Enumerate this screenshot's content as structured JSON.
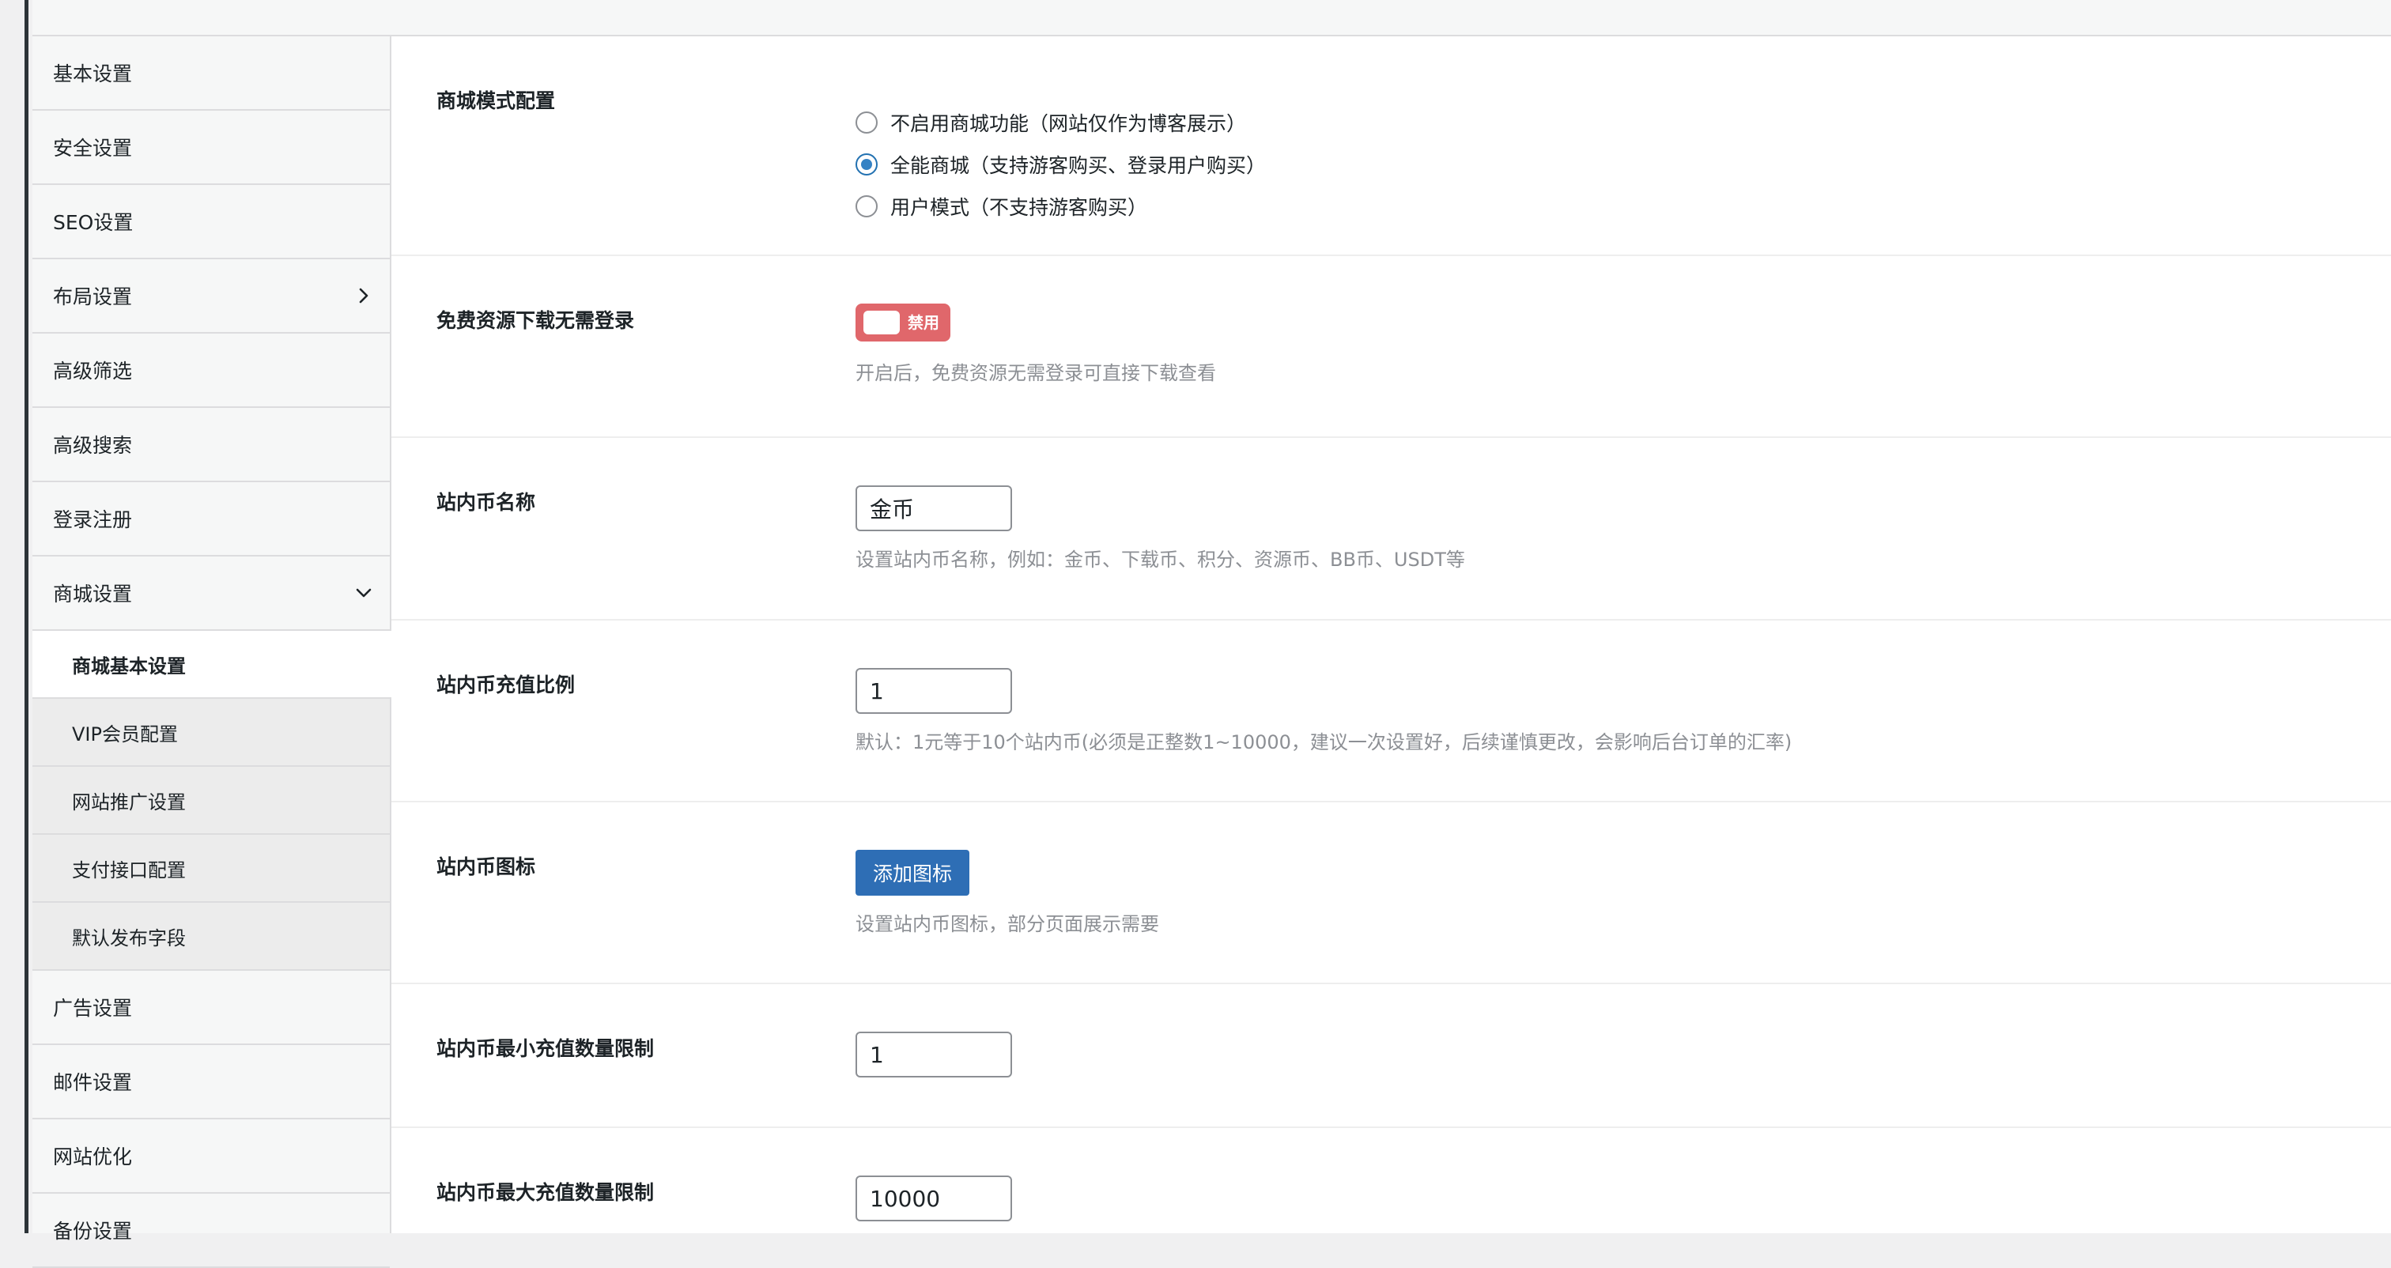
{
  "sidebar": {
    "items": [
      {
        "label": "基本设置"
      },
      {
        "label": "安全设置"
      },
      {
        "label": "SEO设置"
      },
      {
        "label": "布局设置",
        "chevron": "chevron-right-icon"
      },
      {
        "label": "高级筛选"
      },
      {
        "label": "高级搜索"
      },
      {
        "label": "登录注册"
      },
      {
        "label": "商城设置",
        "chevron": "chevron-down-icon"
      }
    ],
    "sub_items": [
      {
        "label": "商城基本设置",
        "active": true
      },
      {
        "label": "VIP会员配置"
      },
      {
        "label": "网站推广设置"
      },
      {
        "label": "支付接口配置"
      },
      {
        "label": "默认发布字段"
      }
    ],
    "items_after": [
      {
        "label": "广告设置"
      },
      {
        "label": "邮件设置"
      },
      {
        "label": "网站优化"
      },
      {
        "label": "备份设置"
      }
    ]
  },
  "settings": {
    "shop_mode": {
      "label": "商城模式配置",
      "options": [
        {
          "label": "不启用商城功能（网站仅作为博客展示）",
          "checked": false
        },
        {
          "label": "全能商城（支持游客购买、登录用户购买）",
          "checked": true
        },
        {
          "label": "用户模式（不支持游客购买）",
          "checked": false
        }
      ]
    },
    "free_download": {
      "label": "免费资源下载无需登录",
      "toggle_text": "禁用",
      "toggle_color": "#e0676b",
      "desc": "开启后，免费资源无需登录可直接下载查看"
    },
    "coin_name": {
      "label": "站内币名称",
      "value": "金币",
      "desc": "设置站内币名称，例如：金币、下载币、积分、资源币、BB币、USDT等"
    },
    "coin_ratio": {
      "label": "站内币充值比例",
      "value": "1",
      "desc": "默认：1元等于10个站内币(必须是正整数1~10000，建议一次设置好，后续谨慎更改，会影响后台订单的汇率)"
    },
    "coin_icon": {
      "label": "站内币图标",
      "button": "添加图标",
      "desc": "设置站内币图标，部分页面展示需要"
    },
    "coin_min": {
      "label": "站内币最小充值数量限制",
      "value": "1"
    },
    "coin_max": {
      "label": "站内币最大充值数量限制",
      "value": "10000"
    }
  }
}
